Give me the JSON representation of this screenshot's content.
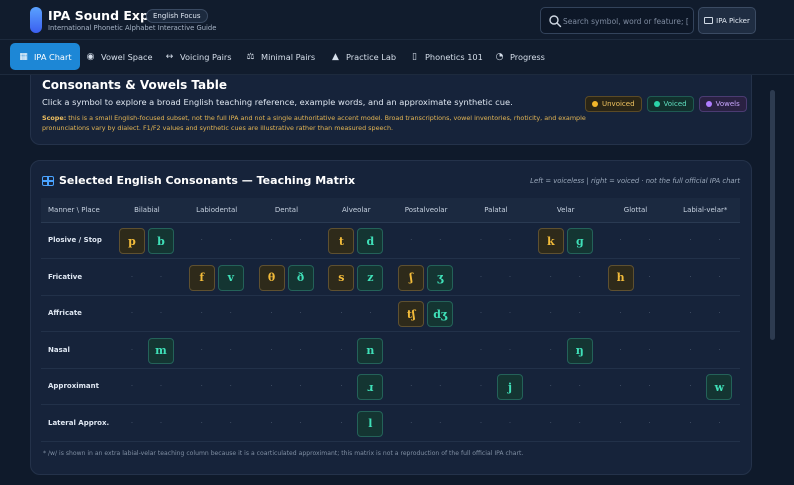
{
  "header": {
    "title": "IPA Sound Explorer",
    "badge": "English Focus",
    "subtitle": "International Phonetic Alphabet Interactive Guide",
    "search_placeholder": "Search symbol, word or feature; [",
    "picker_label": "IPA Picker"
  },
  "nav": {
    "tabs": [
      {
        "label": "IPA Chart",
        "icon": "table-icon",
        "active": true
      },
      {
        "label": "Vowel Space",
        "icon": "target-icon"
      },
      {
        "label": "Voicing Pairs",
        "icon": "swap-icon"
      },
      {
        "label": "Minimal Pairs",
        "icon": "scale-icon"
      },
      {
        "label": "Practice Lab",
        "icon": "cap-icon"
      },
      {
        "label": "Phonetics 101",
        "icon": "book-icon"
      },
      {
        "label": "Progress",
        "icon": "pie-icon"
      }
    ]
  },
  "intro": {
    "title": "Consonants & Vowels Table",
    "description": "Click a symbol to explore a broad English teaching reference, example words, and an approximate synthetic cue.",
    "scope_label": "Scope:",
    "scope_text": "this is a small English-focused subset, not the full IPA and not a single authoritative accent model. Broad transcriptions, vowel inventories, rhoticity, and example pronunciations vary by dialect. F1/F2 values and synthetic cues are illustrative rather than measured speech.",
    "legend": {
      "unvoiced": "Unvoiced",
      "voiced": "Voiced",
      "vowels": "Vowels"
    },
    "colors": {
      "unvoiced": "#f2b62a",
      "voiced": "#2bd4a8",
      "vowels": "#b07cff",
      "accent": "#1d87d6"
    }
  },
  "matrix": {
    "title": "Selected English Consonants — Teaching Matrix",
    "note": "Left = voiceless | right = voiced · not the full official IPA chart",
    "corner": "Manner \\ Place",
    "places": [
      "Bilabial",
      "Labiodental",
      "Dental",
      "Alveolar",
      "Postalveolar",
      "Palatal",
      "Velar",
      "Glottal",
      "Labial-velar*"
    ],
    "rows": [
      {
        "manner": "Plosive / Stop",
        "cells": [
          [
            "p",
            "b"
          ],
          [
            "",
            ""
          ],
          [
            "",
            ""
          ],
          [
            "t",
            "d"
          ],
          [
            "",
            ""
          ],
          [
            "",
            ""
          ],
          [
            "k",
            "ɡ"
          ],
          [
            "",
            ""
          ],
          [
            "",
            ""
          ]
        ]
      },
      {
        "manner": "Fricative",
        "cells": [
          [
            "",
            ""
          ],
          [
            "f",
            "v"
          ],
          [
            "θ",
            "ð"
          ],
          [
            "s",
            "z"
          ],
          [
            "ʃ",
            "ʒ"
          ],
          [
            "",
            ""
          ],
          [
            "",
            ""
          ],
          [
            "h",
            ""
          ],
          [
            "",
            ""
          ]
        ]
      },
      {
        "manner": "Affricate",
        "cells": [
          [
            "",
            ""
          ],
          [
            "",
            ""
          ],
          [
            "",
            ""
          ],
          [
            "",
            ""
          ],
          [
            "tʃ",
            "dʒ"
          ],
          [
            "",
            ""
          ],
          [
            "",
            ""
          ],
          [
            "",
            ""
          ],
          [
            "",
            ""
          ]
        ]
      },
      {
        "manner": "Nasal",
        "cells": [
          [
            "",
            "m"
          ],
          [
            "",
            ""
          ],
          [
            "",
            ""
          ],
          [
            "",
            "n"
          ],
          [
            "",
            ""
          ],
          [
            "",
            ""
          ],
          [
            "",
            "ŋ"
          ],
          [
            "",
            ""
          ],
          [
            "",
            ""
          ]
        ]
      },
      {
        "manner": "Approximant",
        "cells": [
          [
            "",
            ""
          ],
          [
            "",
            ""
          ],
          [
            "",
            ""
          ],
          [
            "",
            "ɹ"
          ],
          [
            "",
            ""
          ],
          [
            "",
            "j"
          ],
          [
            "",
            ""
          ],
          [
            "",
            ""
          ],
          [
            "",
            "w"
          ]
        ]
      },
      {
        "manner": "Lateral Approx.",
        "cells": [
          [
            "",
            ""
          ],
          [
            "",
            ""
          ],
          [
            "",
            ""
          ],
          [
            "",
            "l"
          ],
          [
            "",
            ""
          ],
          [
            "",
            ""
          ],
          [
            "",
            ""
          ],
          [
            "",
            ""
          ],
          [
            "",
            ""
          ]
        ]
      }
    ],
    "footnote": "* /w/ is shown in an extra labial-velar teaching column because it is a coarticulated approximant; this matrix is not a reproduction of the full official IPA chart."
  }
}
